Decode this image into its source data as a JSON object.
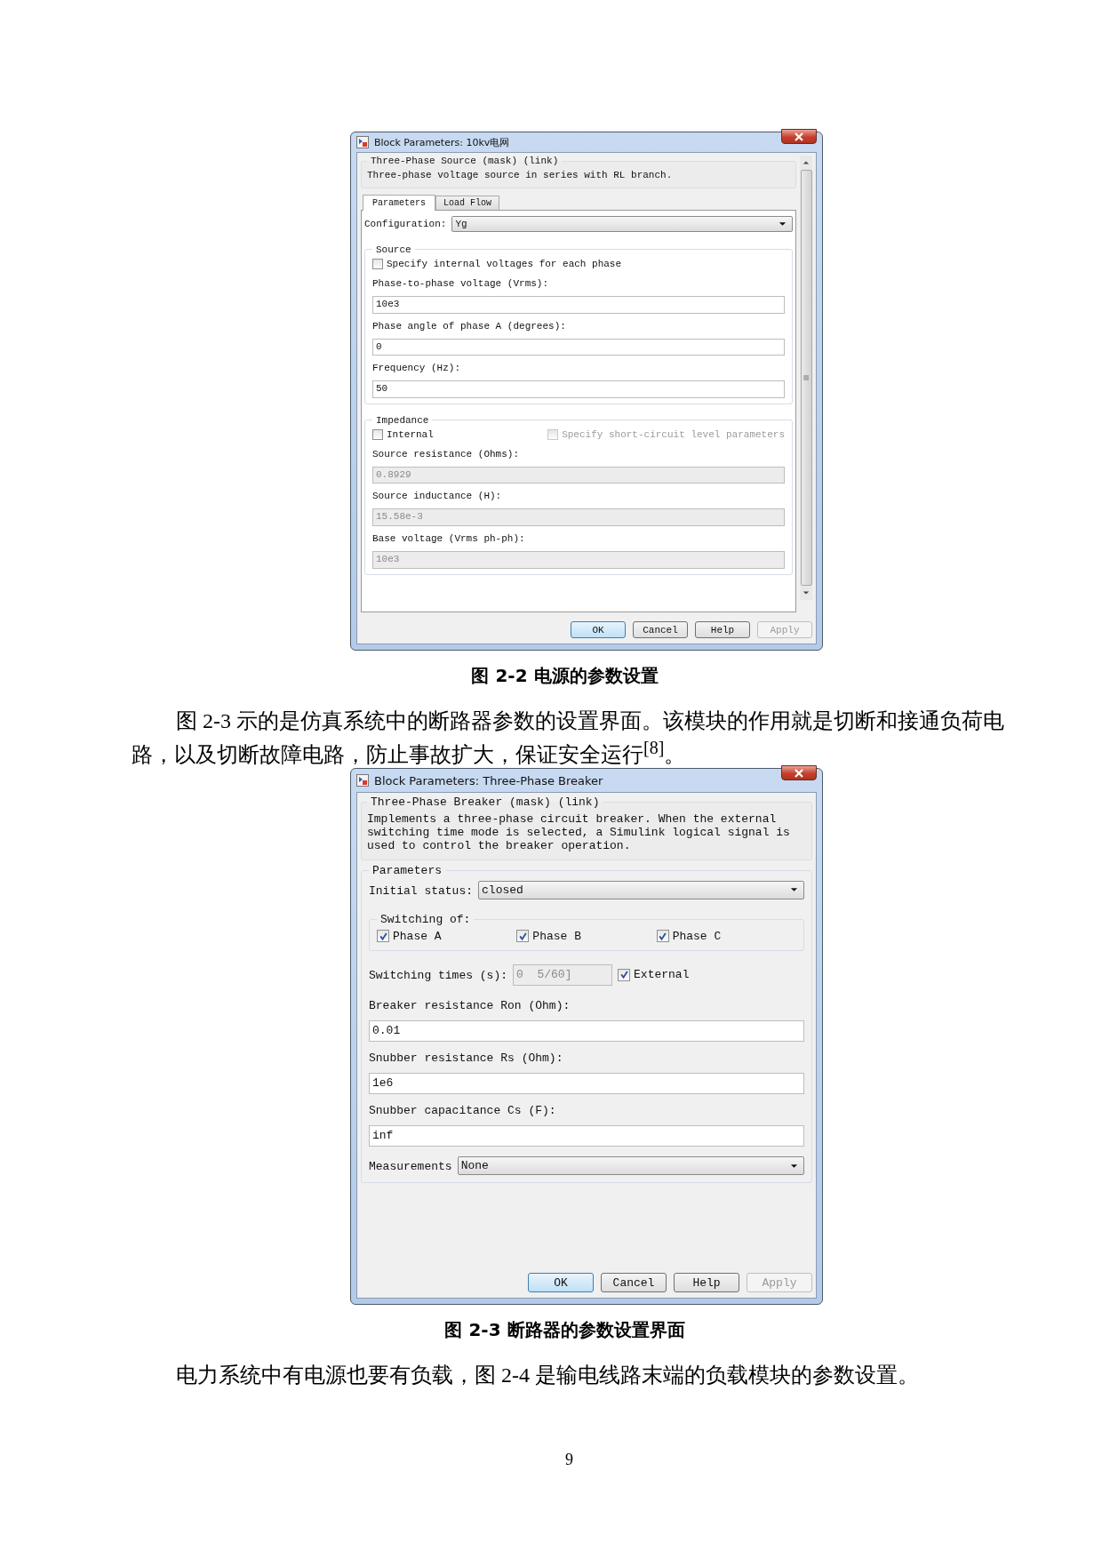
{
  "blocks": [
    {
      "kind": "dialog",
      "title": "Block Parameters: 10kv电网",
      "scrollable": true,
      "header": {
        "title": "Three-Phase Source (mask) (link)",
        "description": "Three-phase voltage source in series with RL branch."
      },
      "tabs": [
        {
          "label": "Parameters",
          "selected": true
        },
        {
          "label": "Load Flow",
          "selected": false
        }
      ],
      "items": [
        {
          "kind": "dropdown",
          "label": "Configuration:",
          "value": "Yg"
        },
        {
          "kind": "group",
          "title": "Source",
          "items": [
            {
              "kind": "checkbox_row",
              "checkboxes": [
                {
                  "label": "Specify internal voltages for each phase",
                  "checked": false,
                  "disabled": false
                }
              ]
            },
            {
              "kind": "label",
              "text": "Phase-to-phase voltage (Vrms):"
            },
            {
              "kind": "field",
              "value": "10e3",
              "disabled": false
            },
            {
              "kind": "label",
              "text": "Phase angle of phase A (degrees):"
            },
            {
              "kind": "field",
              "value": "0",
              "disabled": false
            },
            {
              "kind": "label",
              "text": "Frequency (Hz):"
            },
            {
              "kind": "field",
              "value": "50",
              "disabled": false
            }
          ]
        },
        {
          "kind": "group",
          "title": "Impedance",
          "items": [
            {
              "kind": "checkbox_row",
              "checkboxes": [
                {
                  "label": "Internal",
                  "checked": false,
                  "disabled": false
                },
                {
                  "label": "Specify short-circuit level parameters",
                  "checked": false,
                  "disabled": true
                }
              ]
            },
            {
              "kind": "label",
              "text": "Source resistance (Ohms):"
            },
            {
              "kind": "field",
              "value": "0.8929",
              "disabled": true
            },
            {
              "kind": "label",
              "text": "Source inductance (H):"
            },
            {
              "kind": "field",
              "value": "15.58e-3",
              "disabled": true
            },
            {
              "kind": "label",
              "text": "Base voltage (Vrms ph-ph):"
            },
            {
              "kind": "field",
              "value": "10e3",
              "disabled": true
            }
          ]
        }
      ],
      "buttons": [
        {
          "label": "OK",
          "default": true,
          "disabled": false
        },
        {
          "label": "Cancel",
          "default": false,
          "disabled": false
        },
        {
          "label": "Help",
          "default": false,
          "disabled": false
        },
        {
          "label": "Apply",
          "default": false,
          "disabled": true
        }
      ]
    },
    {
      "kind": "caption",
      "text": "图 2-2 电源的参数设置"
    },
    {
      "kind": "paragraph",
      "text": "图 2-3 示的是仿真系统中的断路器参数的设置界面。该模块的作用就是切断和接通负荷电路，以及切断故障电路，防止事故扩大，保证安全运行$^{[8]}$。"
    },
    {
      "kind": "dialog",
      "title": "Block Parameters: Three-Phase Breaker",
      "scrollable": false,
      "header": {
        "title": "Three-Phase Breaker (mask) (link)",
        "description": "Implements a three-phase circuit breaker. When the external switching time mode is selected, a Simulink logical signal is used to control the breaker operation."
      },
      "items": [
        {
          "kind": "group",
          "title": "Parameters",
          "items": [
            {
              "kind": "dropdown",
              "label": "Initial status:",
              "value": "closed"
            },
            {
              "kind": "group",
              "title": "Switching of:",
              "items": [
                {
                  "kind": "checkbox_row",
                  "checkboxes": [
                    {
                      "label": "Phase A",
                      "checked": true,
                      "disabled": false
                    },
                    {
                      "label": "Phase B",
                      "checked": true,
                      "disabled": false
                    },
                    {
                      "label": "Phase C",
                      "checked": true,
                      "disabled": false
                    }
                  ]
                }
              ]
            },
            {
              "kind": "inline_field",
              "label": "Switching times (s):",
              "value": "0  5/60]",
              "disabled": true,
              "checkbox": {
                "label": "External",
                "checked": true,
                "disabled": false
              }
            },
            {
              "kind": "label",
              "text": "Breaker resistance Ron (Ohm):"
            },
            {
              "kind": "field",
              "value": "0.01",
              "disabled": false
            },
            {
              "kind": "label",
              "text": "Snubber resistance Rs (Ohm):"
            },
            {
              "kind": "field",
              "value": "1e6",
              "disabled": false
            },
            {
              "kind": "label",
              "text": "Snubber capacitance Cs (F):"
            },
            {
              "kind": "field",
              "value": "inf",
              "disabled": false
            },
            {
              "kind": "dropdown",
              "label": "Measurements",
              "value": "None"
            }
          ]
        }
      ],
      "buttons": [
        {
          "label": "OK",
          "default": true,
          "disabled": false
        },
        {
          "label": "Cancel",
          "default": false,
          "disabled": false
        },
        {
          "label": "Help",
          "default": false,
          "disabled": false
        },
        {
          "label": "Apply",
          "default": false,
          "disabled": true
        }
      ]
    },
    {
      "kind": "caption",
      "text": "图 2-3 断路器的参数设置界面"
    },
    {
      "kind": "paragraph",
      "text": "电力系统中有电源也要有负载，图 2-4 是输电线路末端的负载模块的参数设置。"
    },
    {
      "kind": "page_number",
      "text": "9"
    }
  ]
}
